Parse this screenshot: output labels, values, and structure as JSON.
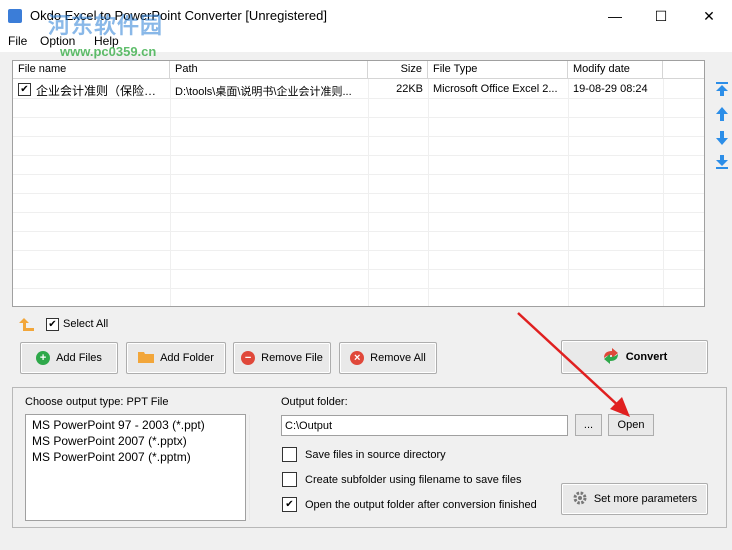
{
  "window": {
    "title": "Okdo Excel to PowerPoint Converter [Unregistered]",
    "minimize_glyph": "—",
    "maximize_glyph": "☐",
    "close_glyph": "✕"
  },
  "watermark": {
    "text": "河东软件园",
    "url": "www.pc0359.cn"
  },
  "menu": [
    "File",
    "Option",
    "Help"
  ],
  "table": {
    "columns": [
      "File name",
      "Path",
      "Size",
      "File Type",
      "Modify date"
    ],
    "rows": [
      {
        "checked": true,
        "name": "企业会计准则（保险公...",
        "path": "D:\\tools\\桌面\\说明书\\企业会计准则...",
        "size": "22KB",
        "type": "Microsoft Office Excel 2...",
        "date": "19-08-29 08:24"
      }
    ]
  },
  "side_arrows": [
    "move-top",
    "move-up",
    "move-down",
    "move-bottom"
  ],
  "select_all": {
    "label": "Select All",
    "checked": true
  },
  "buttons": {
    "add_files": "Add Files",
    "add_folder": "Add Folder",
    "remove_file": "Remove File",
    "remove_all": "Remove All",
    "convert": "Convert"
  },
  "output": {
    "type_label": "Choose output type:  PPT File",
    "formats": [
      "MS PowerPoint 97 - 2003 (*.ppt)",
      "MS PowerPoint 2007 (*.pptx)",
      "MS PowerPoint 2007 (*.pptm)"
    ],
    "folder_label": "Output folder:",
    "folder_value": "C:\\Output",
    "browse_label": "...",
    "open_label": "Open",
    "options": [
      {
        "label": "Save files in source directory",
        "checked": false
      },
      {
        "label": "Create subfolder using filename to save files",
        "checked": false
      },
      {
        "label": "Open the output folder after conversion finished",
        "checked": true
      }
    ],
    "more_params": "Set more parameters"
  },
  "colors": {
    "accent_blue": "#2c8ee8",
    "annotation_red": "#e02020",
    "add_green": "#2ea84a",
    "remove_red": "#e0483a",
    "folder_orange": "#f2a63a"
  }
}
